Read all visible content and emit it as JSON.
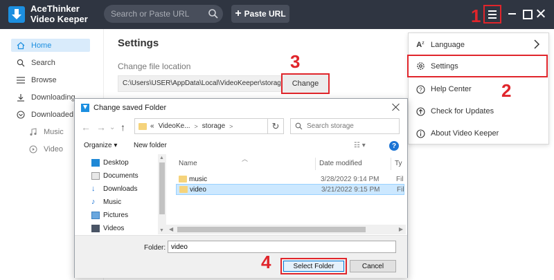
{
  "app": {
    "brand_line1": "AceThinker",
    "brand_line2": "Video Keeper",
    "search_placeholder": "Search or Paste URL",
    "paste_label": "Paste URL",
    "accent_color": "#1c8fe0",
    "annotation_color": "#e0252b"
  },
  "steps": [
    "1",
    "2",
    "3",
    "4"
  ],
  "sidebar": {
    "items": [
      {
        "label": "Home",
        "icon": "home-icon",
        "active": true
      },
      {
        "label": "Search",
        "icon": "search-icon"
      },
      {
        "label": "Browse",
        "icon": "browse-icon"
      },
      {
        "label": "Downloading",
        "icon": "download-icon"
      },
      {
        "label": "Downloaded",
        "icon": "downloaded-icon"
      },
      {
        "label": "Music",
        "icon": "music-icon"
      },
      {
        "label": "Video",
        "icon": "video-icon"
      }
    ]
  },
  "settings": {
    "title": "Settings",
    "location_label": "Change file location",
    "path": "C:\\Users\\USER\\AppData\\Local\\VideoKeeper\\storage",
    "change_label": "Change"
  },
  "menu": {
    "items": [
      {
        "label": "Language",
        "icon": "language-icon"
      },
      {
        "label": "Settings",
        "icon": "gear-icon"
      },
      {
        "label": "Help Center",
        "icon": "help-icon"
      },
      {
        "label": "Check for Updates",
        "icon": "update-icon"
      },
      {
        "label": "About Video Keeper",
        "icon": "info-icon"
      }
    ]
  },
  "dialog": {
    "title": "Change saved Folder",
    "breadcrumb": [
      "«",
      "VideoKe...",
      "storage"
    ],
    "search_placeholder": "Search storage",
    "organize_label": "Organize",
    "new_folder_label": "New folder",
    "tree": [
      "Desktop",
      "Documents",
      "Downloads",
      "Music",
      "Pictures",
      "Videos"
    ],
    "columns": {
      "name": "Name",
      "date": "Date modified",
      "type": "Ty"
    },
    "files": [
      {
        "name": "music",
        "date": "3/28/2022 9:14 PM",
        "type": "Fil"
      },
      {
        "name": "video",
        "date": "3/21/2022 9:15 PM",
        "type": "Fil"
      }
    ],
    "folder_label": "Folder:",
    "folder_value": "video",
    "select_label": "Select Folder",
    "cancel_label": "Cancel"
  }
}
